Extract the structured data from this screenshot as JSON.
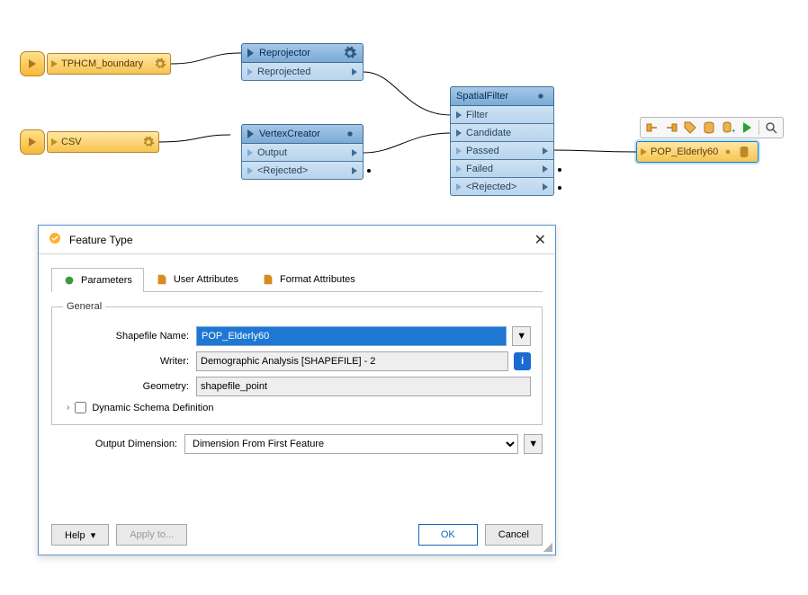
{
  "readers": {
    "tphcm": {
      "label": "TPHCM_boundary"
    },
    "csv": {
      "label": "CSV"
    }
  },
  "transformers": {
    "reproj": {
      "title": "Reprojector",
      "ports_out": [
        "Reprojected"
      ]
    },
    "vtx": {
      "title": "VertexCreator",
      "ports_out": [
        "Output",
        "<Rejected>"
      ]
    },
    "sfilt": {
      "title": "SpatialFilter",
      "ports_in": [
        "Filter",
        "Candidate"
      ],
      "ports_out": [
        "Passed",
        "Failed",
        "<Rejected>"
      ]
    }
  },
  "writer": {
    "label": "POP_Elderly60"
  },
  "toolbar_icons": [
    "link-icon",
    "link-icon-2",
    "tag-icon",
    "db-icon",
    "db-plus-icon",
    "play-icon",
    "search-icon"
  ],
  "dialog": {
    "title": "Feature Type",
    "tabs": [
      "Parameters",
      "User Attributes",
      "Format Attributes"
    ],
    "fieldset": "General",
    "labels": {
      "shapefile": "Shapefile Name:",
      "writer": "Writer:",
      "geometry": "Geometry:",
      "dynamic": "Dynamic Schema Definition",
      "outdim": "Output Dimension:"
    },
    "values": {
      "shapefile": "POP_Elderly60",
      "writer": "Demographic Analysis [SHAPEFILE] - 2",
      "geometry": "shapefile_point",
      "outdim": "Dimension From First Feature"
    },
    "buttons": {
      "help": "Help",
      "apply": "Apply to...",
      "ok": "OK",
      "cancel": "Cancel"
    },
    "info": "i",
    "dd": "▼",
    "chev": "›"
  }
}
